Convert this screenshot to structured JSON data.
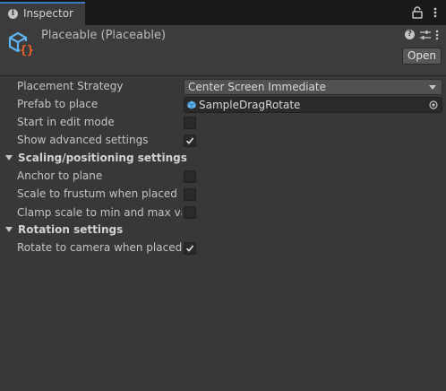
{
  "tab": {
    "label": "Inspector",
    "info_glyph": "i"
  },
  "header": {
    "title": "Placeable (Placeable)",
    "open_label": "Open",
    "help_glyph": "?"
  },
  "fields": {
    "placement_strategy": {
      "label": "Placement Strategy",
      "value": "Center Screen Immediate"
    },
    "prefab_to_place": {
      "label": "Prefab to place",
      "value": "SampleDragRotate"
    },
    "start_in_edit_mode": {
      "label": "Start in edit mode",
      "checked": false
    },
    "show_advanced": {
      "label": "Show advanced settings",
      "checked": true
    }
  },
  "scaling": {
    "title": "Scaling/positioning settings",
    "anchor_to_plane": {
      "label": "Anchor to plane",
      "checked": false
    },
    "scale_to_frustum": {
      "label": "Scale to frustum when placed",
      "checked": false
    },
    "clamp_scale": {
      "label": "Clamp scale to min and max values",
      "checked": false
    }
  },
  "rotation": {
    "title": "Rotation settings",
    "rotate_to_camera": {
      "label": "Rotate to camera when placed",
      "checked": true
    }
  },
  "colors": {
    "background": "#383838",
    "accent": "#3a79bb",
    "script_icon_blue": "#5fb4f0",
    "script_icon_orange": "#f0602a"
  }
}
